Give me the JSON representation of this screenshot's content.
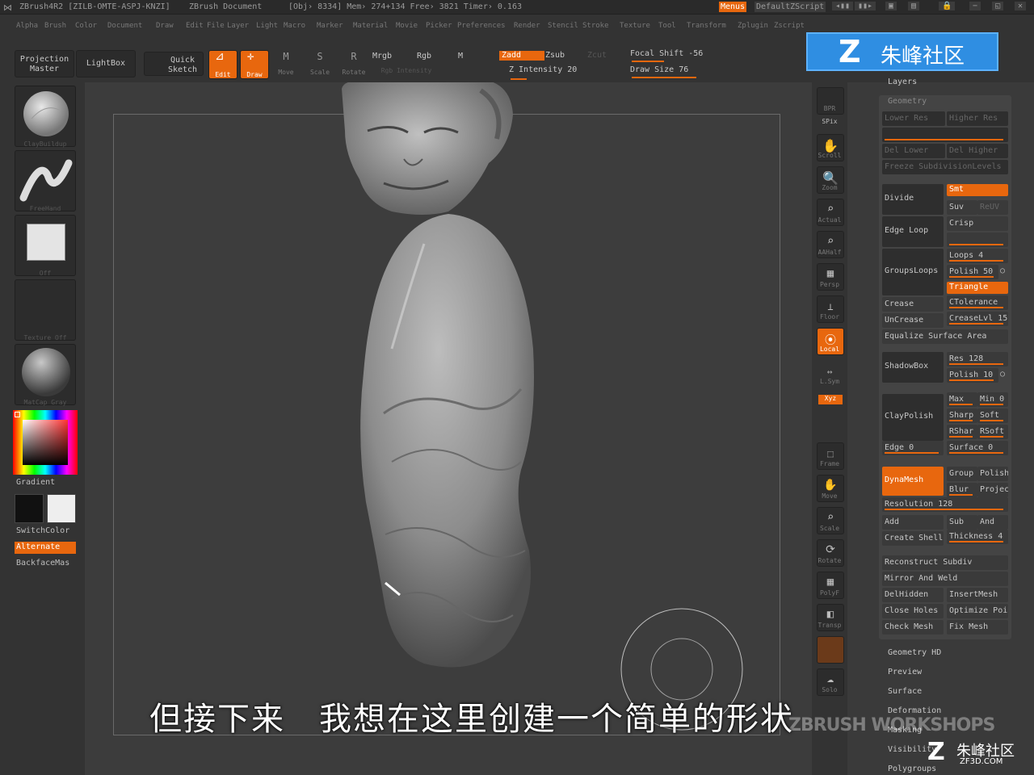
{
  "titlebar": {
    "app": "ZBrush4R2 [ZILB-OMTE-ASPJ-KNZI]",
    "document": "ZBrush Document",
    "stats": "[Obj› 8334] Mem› 274+134 Free› 3821 Timer› 0.163",
    "menus_button": "Menus",
    "zscript": "DefaultZScript"
  },
  "menubar": [
    "Alpha",
    "Brush",
    "Color",
    "Document",
    "Draw",
    "Edit",
    "File",
    "Layer",
    "Light",
    "Macro",
    "Marker",
    "Material",
    "Movie",
    "Picker",
    "Preferences",
    "Render",
    "Stencil",
    "Stroke",
    "Texture",
    "Tool",
    "Transform",
    "Zplugin",
    "Zscript"
  ],
  "toolbar": {
    "projection_master": "Projection Master",
    "lightbox": "LightBox",
    "quick_sketch": "Quick Sketch",
    "edit": "Edit",
    "draw": "Draw",
    "move": "Move",
    "scale": "Scale",
    "rotate": "Rotate",
    "mrgb": "Mrgb",
    "rgb": "Rgb",
    "m": "M",
    "zadd": "Zadd",
    "zsub": "Zsub",
    "zcut": "Zcut",
    "z_intensity": "Z Intensity 20",
    "focal_shift": "Focal Shift -56",
    "draw_size": "Draw Size 76",
    "rgb_intensity": "Rgb Intensity"
  },
  "leftshelf": {
    "brush": "ClayBuildup",
    "stroke": "FreeHand",
    "alpha": "Off",
    "texture": "Texture Off",
    "material": "MatCap Gray",
    "gradient": "Gradient",
    "switchcolor": "SwitchColor",
    "alternate": "Alternate",
    "backface": "BackfaceMas"
  },
  "rightshelf": [
    "BPR",
    "SPix",
    "Scroll",
    "Zoom",
    "Actual",
    "AAHalf",
    "Persp",
    "Floor",
    "Local",
    "L.Sym",
    "Xyz",
    "Frame",
    "Move",
    "Scale",
    "Rotate",
    "PolyF",
    "Transp",
    "Solo"
  ],
  "tray": {
    "layers": "Layers",
    "geometry": "Geometry",
    "top_faded": [
      "Lower Res",
      "Higher Res",
      "Del Lower",
      "Del Higher",
      "Freeze SubdivisionLevels"
    ],
    "divide": "Divide",
    "smt": "Smt",
    "suv": "Suv",
    "rsuv": "ReUV",
    "edge_loop": "Edge Loop",
    "crisp": "Crisp",
    "groupsloops": "GroupsLoops",
    "loops": "Loops 4",
    "polish": "Polish 50",
    "triangle": "Triangle",
    "crease": "Crease",
    "ctolerance": "CTolerance",
    "uncrease": "UnCrease",
    "creaselvl": "CreaseLvl 15",
    "equalize": "Equalize Surface Area",
    "shadowbox": "ShadowBox",
    "res": "Res 128",
    "polish10": "Polish 10",
    "claypolish": "ClayPolish",
    "max": "Max",
    "min": "Min 0",
    "sharp": "Sharp",
    "soft": "Soft",
    "rshar": "RShar",
    "rsoft": "RSoft",
    "edge": "Edge 0",
    "surface0": "Surface 0",
    "dynamesh": "DynaMesh",
    "group": "Group",
    "polish_dm": "Polish",
    "blur": "Blur",
    "project": "Projec",
    "resolution": "Resolution 128",
    "add": "Add",
    "sub": "Sub",
    "and": "And",
    "create_shell": "Create Shell",
    "thickness": "Thickness 4",
    "reconstruct": "Reconstruct Subdiv",
    "mirror": "Mirror And Weld",
    "delhidden": "DelHidden",
    "insertmesh": "InsertMesh",
    "close_holes": "Close Holes",
    "optimize": "Optimize Poi",
    "check_mesh": "Check Mesh",
    "fix_mesh": "Fix Mesh",
    "subpalettes": [
      "Geometry HD",
      "Preview",
      "Surface",
      "Deformation",
      "Masking",
      "Visibility",
      "Polygroups"
    ]
  },
  "subtitle": "但接下来　我想在这里创建一个简单的形状",
  "logo": "朱峰社区",
  "watermark": "ZBRUSH WORKSHOPS",
  "watermark2": "朱峰社区",
  "watermark_url": "ZF3D.COM"
}
